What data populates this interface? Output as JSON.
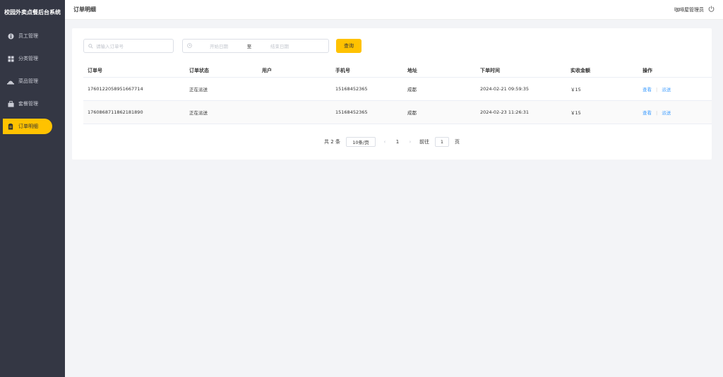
{
  "app": {
    "title": "校园外卖点餐后台系统"
  },
  "sidebar": {
    "items": [
      {
        "label": "员工管理",
        "icon": "info-icon",
        "active": false
      },
      {
        "label": "分类管理",
        "icon": "grid-icon",
        "active": false
      },
      {
        "label": "菜品管理",
        "icon": "dish-icon",
        "active": false
      },
      {
        "label": "套餐管理",
        "icon": "package-icon",
        "active": false
      },
      {
        "label": "订单明细",
        "icon": "order-icon",
        "active": true
      }
    ]
  },
  "header": {
    "title": "订单明细",
    "user": "咖啡屋管理员"
  },
  "search": {
    "order_placeholder": "请输入订单号",
    "start_placeholder": "开始日期",
    "range_sep": "至",
    "end_placeholder": "结束日期",
    "query_label": "查询"
  },
  "table": {
    "columns": [
      "订单号",
      "订单状态",
      "用户",
      "手机号",
      "地址",
      "下单时间",
      "实收金额",
      "操作"
    ],
    "rows": [
      {
        "order_no": "1760122058951667714",
        "status": "正在派送",
        "user": "",
        "phone": "15168452365",
        "address": "成都",
        "time": "2024-02-21 09:59:35",
        "amount": "￥15",
        "op_view": "查看",
        "op_deliver": "派送"
      },
      {
        "order_no": "1760868711862181890",
        "status": "正在派送",
        "user": "",
        "phone": "15168452365",
        "address": "成都",
        "time": "2024-02-23 11:26:31",
        "amount": "￥15",
        "op_view": "查看",
        "op_deliver": "派送"
      }
    ],
    "op_sep": "|"
  },
  "pager": {
    "total": "共 2 条",
    "size": "10条/页",
    "prev": "‹",
    "page": "1",
    "next": "›",
    "goto_prefix": "前往",
    "goto_value": "1",
    "goto_suffix": "页"
  },
  "colors": {
    "sidebar_bg": "#343744",
    "accent": "#ffc200",
    "link": "#409eff"
  }
}
